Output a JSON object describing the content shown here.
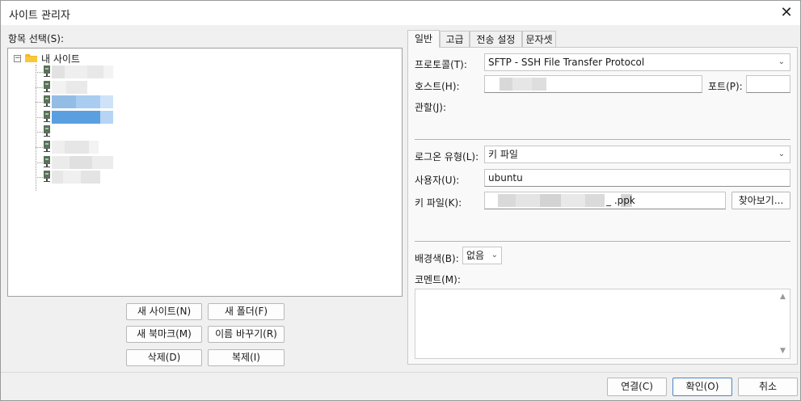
{
  "window": {
    "title": "사이트 관리자"
  },
  "left": {
    "select_label": "항목 선택(S):",
    "tree_root": "내 사이트",
    "site_count": 8,
    "selected_index": 3
  },
  "buttons": {
    "new_site": "새 사이트(N)",
    "new_folder": "새 폴더(F)",
    "new_bookmark": "새 북마크(M)",
    "rename": "이름 바꾸기(R)",
    "delete": "삭제(D)",
    "duplicate": "복제(I)"
  },
  "tabs": [
    {
      "label": "일반",
      "active": true
    },
    {
      "label": "고급",
      "active": false
    },
    {
      "label": "전송 설정",
      "active": false
    },
    {
      "label": "문자셋",
      "active": false
    }
  ],
  "general": {
    "protocol_label": "프로토콜(T):",
    "protocol_value": "SFTP - SSH File Transfer Protocol",
    "host_label": "호스트(H):",
    "host_value": "",
    "port_label": "포트(P):",
    "port_value": "",
    "encryption_label": "관할(J):",
    "logon_type_label": "로그온 유형(L):",
    "logon_type_value": "키 파일",
    "user_label": "사용자(U):",
    "user_value": "ubuntu",
    "keyfile_label": "키 파일(K):",
    "keyfile_value": "_ .ppk",
    "browse_label": "찾아보기...",
    "background_label": "배경색(B):",
    "background_value": "없음",
    "comment_label": "코멘트(M):"
  },
  "footer": {
    "connect": "연결(C)",
    "ok": "확인(O)",
    "cancel": "취소"
  },
  "colors": {
    "selection": "#5aa0e0",
    "selection_light": "#cce2fa",
    "folder": "#f2b824"
  }
}
